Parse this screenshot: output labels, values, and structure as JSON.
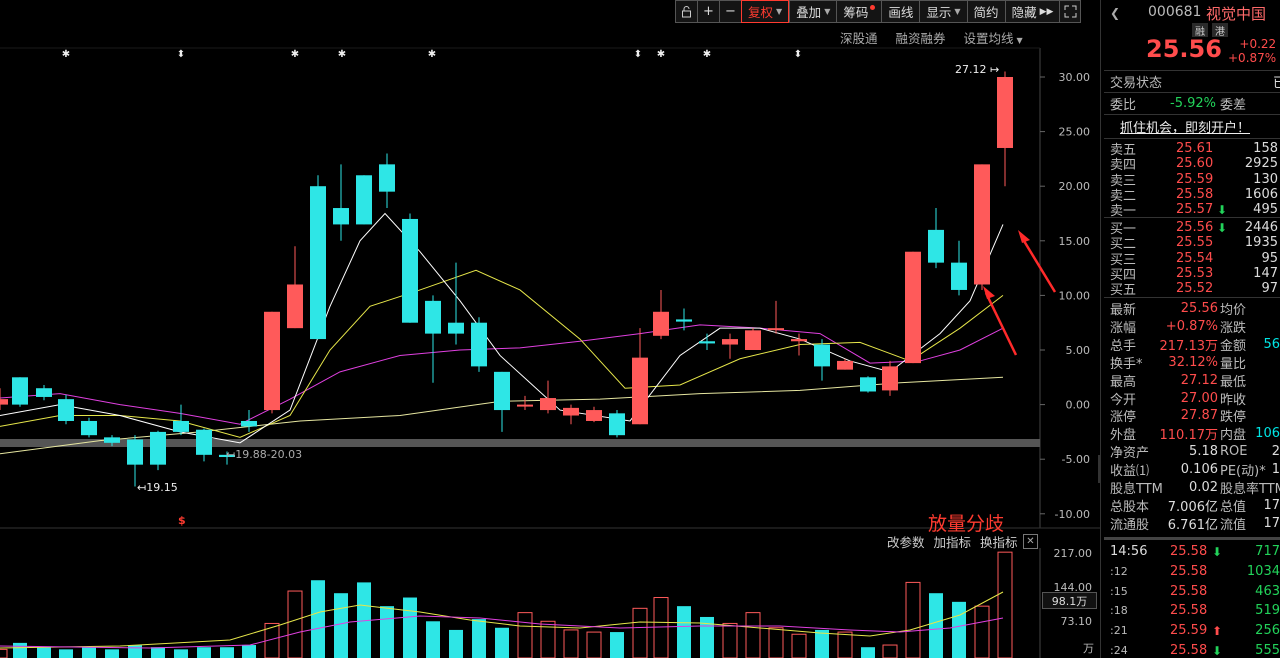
{
  "toolbar": {
    "lock_icon": "lock-icon",
    "plus": "+",
    "minus": "−",
    "fuquan": "复权",
    "diejia": "叠加",
    "chouma": "筹码",
    "huaxian": "画线",
    "xianshi": "显示",
    "jianyue": "简约",
    "yincang": "隐藏",
    "expand": "▶▶",
    "fullscreen_icon": "fullscreen-icon"
  },
  "chart_tools": {
    "shengutong": "深股通",
    "rongzi": "融资融券",
    "ma_settings": "设置均线"
  },
  "chart_data": {
    "type": "candlestick",
    "y_axis_ticks": [
      "30.00",
      "25.00",
      "20.00",
      "15.00",
      "10.00",
      "5.00",
      "0.00",
      "-5.00",
      "-10.00"
    ],
    "annotations": {
      "high_label": "27.12",
      "low_label": "19.15",
      "range_label": "19.88-20.03",
      "zone_marker": "$"
    },
    "volume_axis_ticks": [
      "217.00",
      "144.00",
      "73.10"
    ],
    "volume_unit": "万"
  },
  "indicator": {
    "title": "放量分歧",
    "gaicanshu": "改参数",
    "jiazhibiao": "加指标",
    "huanzhibiao": "换指标",
    "close": "✕",
    "vol_readout": "98.1万"
  },
  "panel": {
    "collapse": "❮",
    "code": "000681",
    "name": "视觉中国",
    "tag_rong": "融",
    "tag_gang": "港",
    "price": "25.56",
    "change": "+0.22",
    "change_pct": "+0.87%",
    "trade_status": "交易状态",
    "trade_status_val": "已",
    "weibi_label": "委比",
    "weibi_val": "-5.92%",
    "weicha_label": "委差",
    "promo": "抓住机会，即刻开户！",
    "sell": [
      {
        "label": "卖五",
        "price": "25.61",
        "vol": "158"
      },
      {
        "label": "卖四",
        "price": "25.60",
        "vol": "2925"
      },
      {
        "label": "卖三",
        "price": "25.59",
        "vol": "130"
      },
      {
        "label": "卖二",
        "price": "25.58",
        "vol": "1606"
      },
      {
        "label": "卖一",
        "price": "25.57",
        "vol": "495"
      }
    ],
    "buy": [
      {
        "label": "买一",
        "price": "25.56",
        "vol": "2446"
      },
      {
        "label": "买二",
        "price": "25.55",
        "vol": "1935"
      },
      {
        "label": "买三",
        "price": "25.54",
        "vol": "95"
      },
      {
        "label": "买四",
        "price": "25.53",
        "vol": "147"
      },
      {
        "label": "买五",
        "price": "25.52",
        "vol": "97"
      }
    ],
    "stats": [
      {
        "l1": "最新",
        "v1": "25.56",
        "l2": "均价",
        "v2": ""
      },
      {
        "l1": "涨幅",
        "v1": "+0.87%",
        "l2": "涨跌",
        "v2": ""
      },
      {
        "l1": "总手",
        "v1": "217.13万",
        "l2": "金额",
        "v2": "56"
      },
      {
        "l1": "换手*",
        "v1": "32.12%",
        "l2": "量比",
        "v2": ""
      },
      {
        "l1": "最高",
        "v1": "27.12",
        "l2": "最低",
        "v2": ""
      },
      {
        "l1": "今开",
        "v1": "27.00",
        "l2": "昨收",
        "v2": ""
      },
      {
        "l1": "涨停",
        "v1": "27.87",
        "l2": "跌停",
        "v2": ""
      },
      {
        "l1": "外盘",
        "v1": "110.17万",
        "l2": "内盘",
        "v2": "106"
      },
      {
        "l1": "净资产",
        "v1": "5.18",
        "l2": "ROE",
        "v2": "2"
      },
      {
        "l1": "收益⑴",
        "v1": "0.106",
        "l2": "PE(动)*",
        "v2": "1"
      },
      {
        "l1": "股息TTM",
        "v1": "0.02",
        "l2": "股息率TTM",
        "v2": ""
      },
      {
        "l1": "总股本",
        "v1": "7.006亿",
        "l2": "总值",
        "v2": "17"
      },
      {
        "l1": "流通股",
        "v1": "6.761亿",
        "l2": "流值",
        "v2": "17"
      }
    ],
    "ticks": [
      {
        "time": "14:56",
        "price": "25.58",
        "dir": "down",
        "vol": "717"
      },
      {
        "time": ":12",
        "price": "25.58",
        "dir": "",
        "vol": "1034"
      },
      {
        "time": ":15",
        "price": "25.58",
        "dir": "",
        "vol": "463"
      },
      {
        "time": ":18",
        "price": "25.58",
        "dir": "",
        "vol": "519"
      },
      {
        "time": ":21",
        "price": "25.59",
        "dir": "up",
        "vol": "256"
      },
      {
        "time": ":24",
        "price": "25.58",
        "dir": "down",
        "vol": "555"
      }
    ]
  }
}
